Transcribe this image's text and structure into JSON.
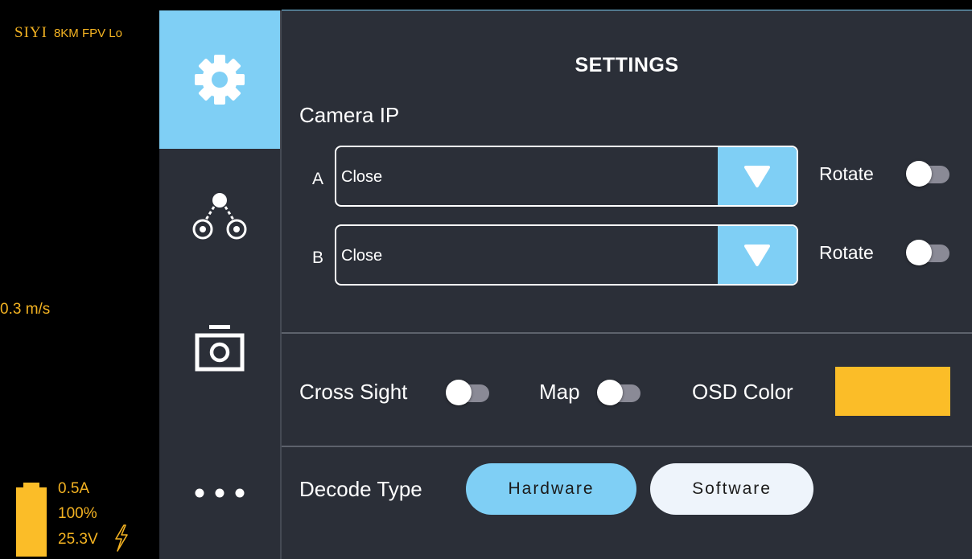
{
  "osd": {
    "brand_logo": "SIYI",
    "product": "8KM FPV Lo",
    "speed": "0.3 m/s",
    "current": "0.5A",
    "battery_percent": "100%",
    "battery_level": 1.0,
    "voltage": "25.3V",
    "color": "#f4b322"
  },
  "nav": {
    "items": [
      {
        "name": "settings",
        "icon": "gear-icon",
        "active": true
      },
      {
        "name": "link",
        "icon": "link-nodes-icon",
        "active": false
      },
      {
        "name": "camera",
        "icon": "camera-icon",
        "active": false
      },
      {
        "name": "more",
        "icon": "more-dots-icon",
        "active": false
      }
    ]
  },
  "settings": {
    "title": "SETTINGS",
    "camera_ip_label": "Camera IP",
    "camera_a": {
      "label": "A",
      "value": "Close",
      "rotate_label": "Rotate",
      "rotate_on": false
    },
    "camera_b": {
      "label": "B",
      "value": "Close",
      "rotate_label": "Rotate",
      "rotate_on": false
    },
    "cross_sight": {
      "label": "Cross Sight",
      "on": false
    },
    "map": {
      "label": "Map",
      "on": false
    },
    "osd_color": {
      "label": "OSD Color",
      "value": "#fbbd28"
    },
    "decode_type": {
      "label": "Decode Type",
      "options": [
        "Hardware",
        "Software"
      ],
      "selected": "Hardware"
    }
  },
  "colors": {
    "accent": "#7fcff5",
    "panel": "#2b2f38",
    "osd_yellow": "#f4b322"
  }
}
